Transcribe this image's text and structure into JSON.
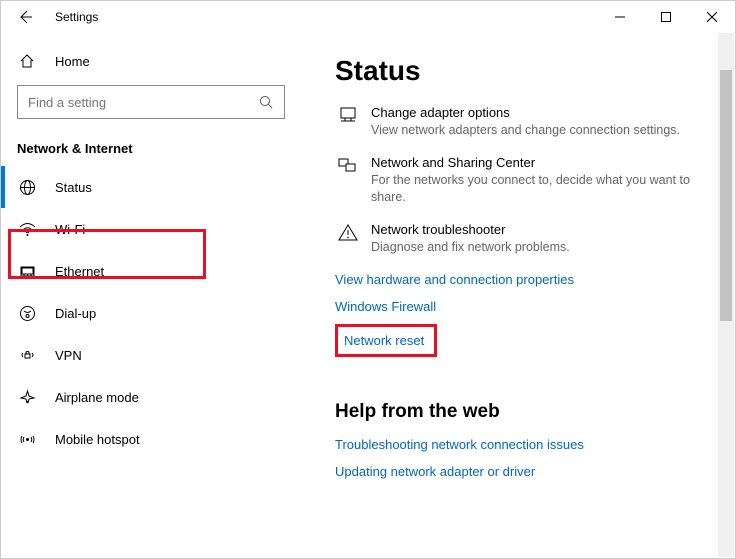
{
  "window": {
    "title": "Settings"
  },
  "sidebar": {
    "home": "Home",
    "search_placeholder": "Find a setting",
    "category": "Network & Internet",
    "items": [
      {
        "label": "Status"
      },
      {
        "label": "Wi-Fi"
      },
      {
        "label": "Ethernet"
      },
      {
        "label": "Dial-up"
      },
      {
        "label": "VPN"
      },
      {
        "label": "Airplane mode"
      },
      {
        "label": "Mobile hotspot"
      }
    ]
  },
  "main": {
    "title": "Status",
    "options": [
      {
        "title": "Change adapter options",
        "desc": "View network adapters and change connection settings."
      },
      {
        "title": "Network and Sharing Center",
        "desc": "For the networks you connect to, decide what you want to share."
      },
      {
        "title": "Network troubleshooter",
        "desc": "Diagnose and fix network problems."
      }
    ],
    "links": {
      "hardware": "View hardware and connection properties",
      "firewall": "Windows Firewall",
      "reset": "Network reset"
    },
    "help_title": "Help from the web",
    "help_links": {
      "troubleshoot": "Troubleshooting network connection issues",
      "update": "Updating network adapter or driver"
    }
  }
}
